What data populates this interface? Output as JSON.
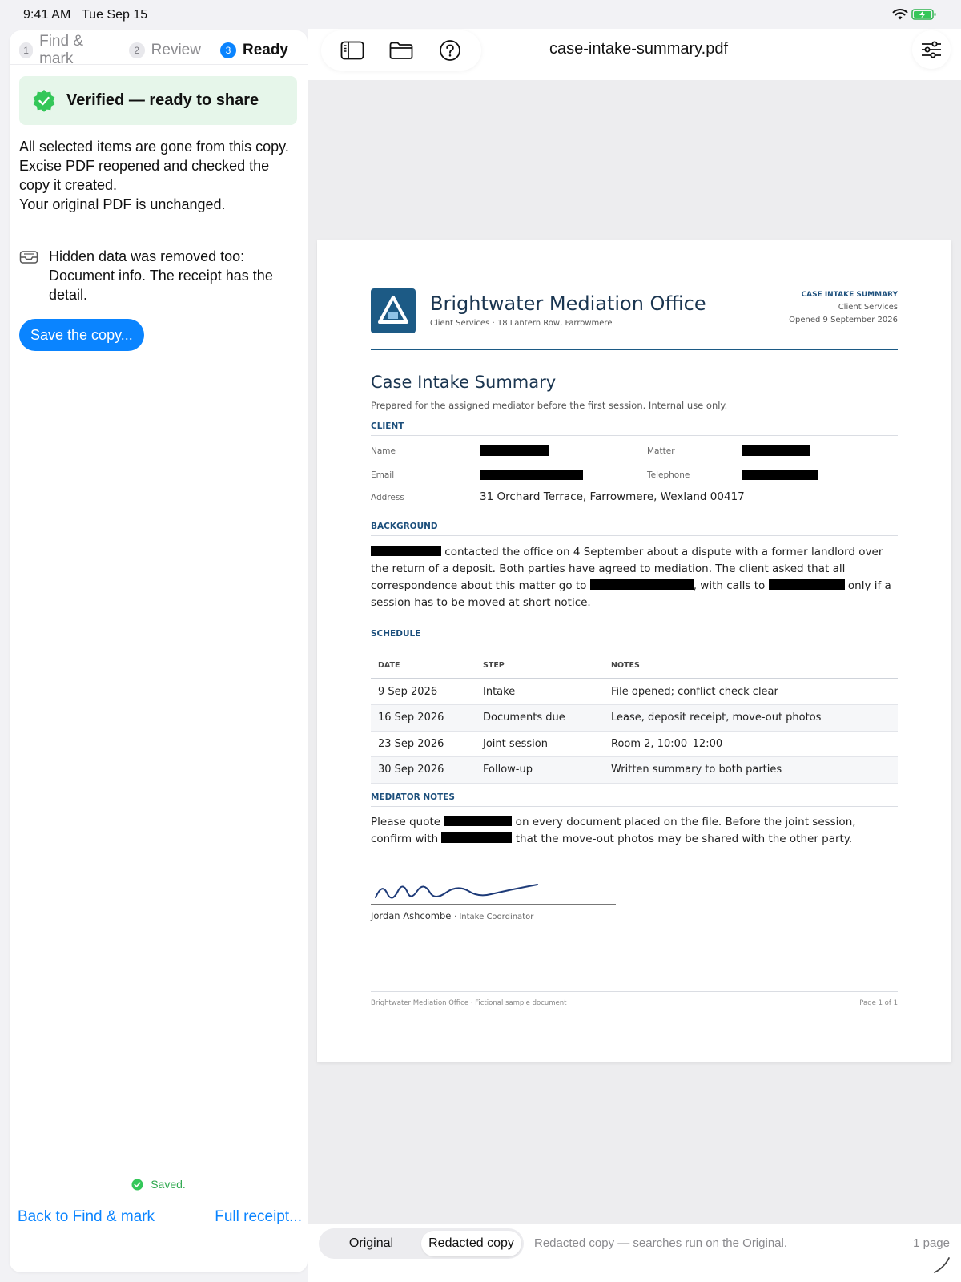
{
  "status_bar": {
    "time": "9:41 AM",
    "date": "Tue Sep 15"
  },
  "steps": [
    {
      "num": "1",
      "label": "Find & mark"
    },
    {
      "num": "2",
      "label": "Review"
    },
    {
      "num": "3",
      "label": "Ready",
      "active": true
    }
  ],
  "verified": {
    "text": "Verified — ready to share"
  },
  "message": {
    "line1": "All selected items are gone from this copy.",
    "line2": "Excise PDF reopened and checked the copy it created.",
    "line3": "Your original PDF is unchanged."
  },
  "hidden_data": {
    "text": "Hidden data was removed too: Document info. The receipt has the detail."
  },
  "save_button": "Save the copy...",
  "saved_status": "Saved.",
  "footer": {
    "back": "Back to Find & mark",
    "receipt": "Full receipt..."
  },
  "toolbar": {
    "title": "case-intake-summary.pdf",
    "icons": [
      "sidebar-icon",
      "folder-icon",
      "help-icon",
      "sliders-icon"
    ]
  },
  "document": {
    "org_name": "Brightwater Mediation Office",
    "org_sub": "Client Services · 18 Lantern Row, Farrowmere",
    "header_kind": "CASE INTAKE SUMMARY",
    "header_dept": "Client Services",
    "header_opened": "Opened 9 September 2026",
    "title": "Case Intake Summary",
    "lede": "Prepared for the assigned mediator before the first session. Internal use only.",
    "client": {
      "heading": "CLIENT",
      "name_label": "Name",
      "matter_label": "Matter",
      "email_label": "Email",
      "phone_label": "Telephone",
      "address_label": "Address",
      "address": "31 Orchard Terrace, Farrowmere, Wexland 00417"
    },
    "background": {
      "heading": "BACKGROUND",
      "t1": " contacted the office on 4 September about a dispute with a former landlord over the return of a deposit. Both parties have agreed to mediation. The client asked that all correspondence about this matter go to ",
      "t2": ", with calls to ",
      "t3": " only if a session has to be moved at short notice."
    },
    "schedule": {
      "heading": "SCHEDULE",
      "columns": [
        "DATE",
        "STEP",
        "NOTES"
      ],
      "rows": [
        [
          "9 Sep 2026",
          "Intake",
          "File opened; conflict check clear"
        ],
        [
          "16 Sep 2026",
          "Documents due",
          "Lease, deposit receipt, move-out photos"
        ],
        [
          "23 Sep 2026",
          "Joint session",
          "Room 2, 10:00–12:00"
        ],
        [
          "30 Sep 2026",
          "Follow-up",
          "Written summary to both parties"
        ]
      ]
    },
    "mediator_notes": {
      "heading": "MEDIATOR NOTES",
      "t1": "Please quote ",
      "t2": " on every document placed on the file. Before the joint session, confirm with ",
      "t3": " that the move-out photos may be shared with the other party."
    },
    "signature": {
      "name": "Jordan Ashcombe",
      "role": "· Intake Coordinator"
    },
    "footer_left": "Brightwater Mediation Office · Fictional sample document",
    "footer_right": "Page 1 of 1"
  },
  "bottom": {
    "seg_original": "Original",
    "seg_redacted": "Redacted copy",
    "hint": "Redacted copy — searches run on the Original.",
    "page_count": "1 page"
  },
  "colors": {
    "accent": "#0a84ff",
    "verified_bg": "#e6f6ea",
    "success": "#2fa84f",
    "brand": "#1c5a85"
  }
}
